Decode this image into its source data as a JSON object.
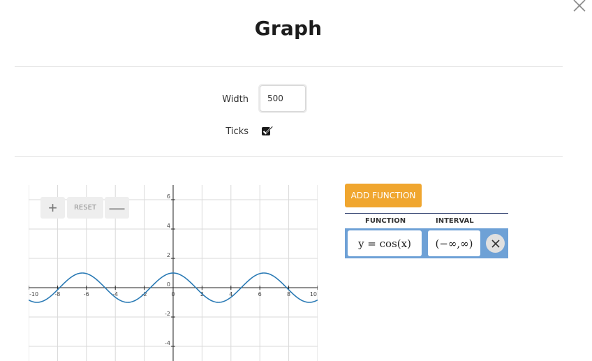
{
  "dialog": {
    "title": "Graph",
    "close_icon": "close-icon"
  },
  "settings": {
    "width_label": "Width",
    "width_value": "500",
    "ticks_label": "Ticks",
    "ticks_checked": true
  },
  "zoom": {
    "plus_label": "+",
    "reset_label": "RESET",
    "minus_label": "—"
  },
  "functions_panel": {
    "add_button": "ADD FUNCTION",
    "col_function": "FUNCTION",
    "col_interval": "INTERVAL",
    "rows": [
      {
        "function": "y = cos(x)",
        "interval": "(−∞,∞)"
      }
    ]
  },
  "colors": {
    "accent": "#f0a62f",
    "row_bg": "#6ea1d6",
    "curve": "#2a7ab5"
  },
  "chart_data": {
    "type": "line",
    "x_ticks": [
      "-10",
      "-8",
      "-6",
      "-4",
      "-2",
      "0",
      "2",
      "4",
      "6",
      "8",
      "10"
    ],
    "y_ticks": [
      "6",
      "4",
      "2",
      "0",
      "-2",
      "-4"
    ],
    "xlim": [
      -10,
      10
    ],
    "ylim": [
      -5,
      7
    ],
    "grid": true,
    "series": [
      {
        "function": "cos(x)",
        "x_range": [
          -10,
          10
        ]
      }
    ]
  }
}
